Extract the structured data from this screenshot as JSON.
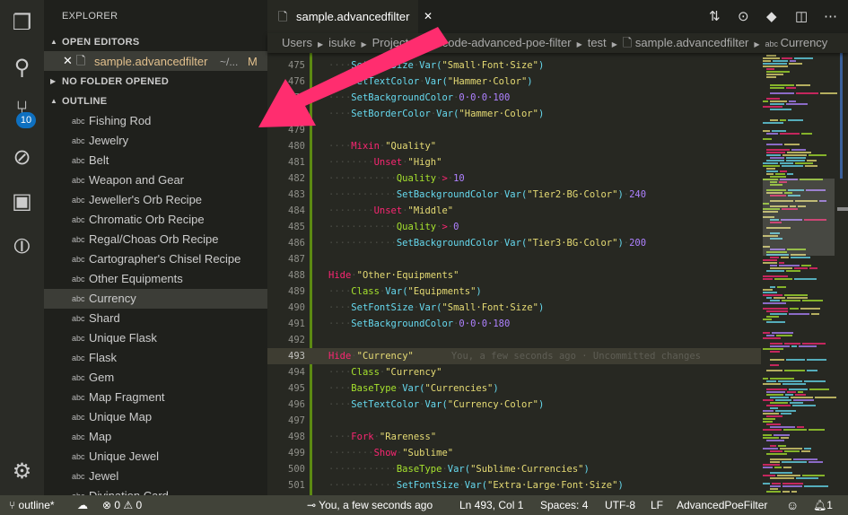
{
  "activity": {
    "scm_badge": "10",
    "icons": [
      "files-icon",
      "search-icon",
      "source-control-icon",
      "debug-icon",
      "extensions-icon",
      "git-graph-icon",
      "gear-icon"
    ]
  },
  "sidebar": {
    "title": "EXPLORER",
    "open_editors": "OPEN EDITORS",
    "open_file": {
      "name": "sample.advancedfilter",
      "path": "~/...",
      "status": "M"
    },
    "no_folder": "NO FOLDER OPENED",
    "outline": "OUTLINE",
    "outline_items": [
      "Fishing Rod",
      "Jewelry",
      "Belt",
      "Weapon and Gear",
      "Jeweller's Orb Recipe",
      "Chromatic Orb Recipe",
      "Regal/Choas Orb Recipe",
      "Cartographer's Chisel Recipe",
      "Other Equipments",
      "Currency",
      "Shard",
      "Unique Flask",
      "Flask",
      "Gem",
      "Map Fragment",
      "Unique Map",
      "Map",
      "Unique Jewel",
      "Jewel",
      "Divination Card"
    ],
    "selected": "Currency",
    "symbol_icon": "abc"
  },
  "tab": {
    "label": "sample.advancedfilter"
  },
  "breadcrumb": [
    "Users",
    "isuke",
    "Projects",
    "vscode-advanced-poe-filter",
    "test",
    "sample.advancedfilter",
    "Currency"
  ],
  "editor": {
    "current_line": 493,
    "blame": "You, a few seconds ago · Uncommitted changes",
    "lines": [
      {
        "n": 475,
        "t": [
          [
            "w",
            "····"
          ],
          [
            "f",
            "SetFontSize"
          ],
          [
            "w",
            "·"
          ],
          [
            "f",
            "Var("
          ],
          [
            "s",
            "\"Small·Font·Size\""
          ],
          [
            "f",
            ")"
          ]
        ]
      },
      {
        "n": 476,
        "t": [
          [
            "w",
            "····"
          ],
          [
            "f",
            "SetTextColor"
          ],
          [
            "w",
            "·"
          ],
          [
            "f",
            "Var("
          ],
          [
            "s",
            "\"Hammer·Color\""
          ],
          [
            "f",
            ")"
          ]
        ]
      },
      {
        "n": 477,
        "t": [
          [
            "w",
            "····"
          ],
          [
            "f",
            "SetBackgroundColor"
          ],
          [
            "w",
            "·"
          ],
          [
            "n",
            "0·0·0·100"
          ]
        ]
      },
      {
        "n": 478,
        "t": [
          [
            "w",
            "····"
          ],
          [
            "f",
            "SetBorderColor"
          ],
          [
            "w",
            "·"
          ],
          [
            "f",
            "Var("
          ],
          [
            "s",
            "\"Hammer·Color\""
          ],
          [
            "f",
            ")"
          ]
        ]
      },
      {
        "n": 479,
        "t": []
      },
      {
        "n": 480,
        "t": [
          [
            "w",
            "····"
          ],
          [
            "k",
            "Mixin"
          ],
          [
            "w",
            "·"
          ],
          [
            "s",
            "\"Quality\""
          ]
        ]
      },
      {
        "n": 481,
        "t": [
          [
            "w",
            "········"
          ],
          [
            "k",
            "Unset"
          ],
          [
            "w",
            "·"
          ],
          [
            "s",
            "\"High\""
          ]
        ]
      },
      {
        "n": 482,
        "t": [
          [
            "w",
            "············"
          ],
          [
            "g",
            "Quality"
          ],
          [
            "w",
            "·"
          ],
          [
            "k",
            ">"
          ],
          [
            "w",
            "·"
          ],
          [
            "n",
            "10"
          ]
        ]
      },
      {
        "n": 483,
        "t": [
          [
            "w",
            "············"
          ],
          [
            "f",
            "SetBackgroundColor"
          ],
          [
            "w",
            "·"
          ],
          [
            "f",
            "Var("
          ],
          [
            "s",
            "\"Tier2·BG·Color\""
          ],
          [
            "f",
            ")"
          ],
          [
            "w",
            "·"
          ],
          [
            "n",
            "240"
          ]
        ]
      },
      {
        "n": 484,
        "t": [
          [
            "w",
            "········"
          ],
          [
            "k",
            "Unset"
          ],
          [
            "w",
            "·"
          ],
          [
            "s",
            "\"Middle\""
          ]
        ]
      },
      {
        "n": 485,
        "t": [
          [
            "w",
            "············"
          ],
          [
            "g",
            "Quality"
          ],
          [
            "w",
            "·"
          ],
          [
            "k",
            ">"
          ],
          [
            "w",
            "·"
          ],
          [
            "n",
            "0"
          ]
        ]
      },
      {
        "n": 486,
        "t": [
          [
            "w",
            "············"
          ],
          [
            "f",
            "SetBackgroundColor"
          ],
          [
            "w",
            "·"
          ],
          [
            "f",
            "Var("
          ],
          [
            "s",
            "\"Tier3·BG·Color\""
          ],
          [
            "f",
            ")"
          ],
          [
            "w",
            "·"
          ],
          [
            "n",
            "200"
          ]
        ]
      },
      {
        "n": 487,
        "t": []
      },
      {
        "n": 488,
        "t": [
          [
            "k",
            "Hide"
          ],
          [
            "w",
            "·"
          ],
          [
            "s",
            "\"Other·Equipments\""
          ]
        ]
      },
      {
        "n": 489,
        "t": [
          [
            "w",
            "····"
          ],
          [
            "g",
            "Class"
          ],
          [
            "w",
            "·"
          ],
          [
            "f",
            "Var("
          ],
          [
            "s",
            "\"Equipments\""
          ],
          [
            "f",
            ")"
          ]
        ]
      },
      {
        "n": 490,
        "t": [
          [
            "w",
            "····"
          ],
          [
            "f",
            "SetFontSize"
          ],
          [
            "w",
            "·"
          ],
          [
            "f",
            "Var("
          ],
          [
            "s",
            "\"Small·Font·Size\""
          ],
          [
            "f",
            ")"
          ]
        ]
      },
      {
        "n": 491,
        "t": [
          [
            "w",
            "····"
          ],
          [
            "f",
            "SetBackgroundColor"
          ],
          [
            "w",
            "·"
          ],
          [
            "n",
            "0·0·0·180"
          ]
        ]
      },
      {
        "n": 492,
        "t": []
      },
      {
        "n": 493,
        "t": [
          [
            "k",
            "Hide"
          ],
          [
            "w",
            "·"
          ],
          [
            "s",
            "\"Currency\""
          ]
        ]
      },
      {
        "n": 494,
        "t": [
          [
            "w",
            "····"
          ],
          [
            "g",
            "Class"
          ],
          [
            "w",
            "·"
          ],
          [
            "s",
            "\"Currency\""
          ]
        ]
      },
      {
        "n": 495,
        "t": [
          [
            "w",
            "····"
          ],
          [
            "g",
            "BaseType"
          ],
          [
            "w",
            "·"
          ],
          [
            "f",
            "Var("
          ],
          [
            "s",
            "\"Currencies\""
          ],
          [
            "f",
            ")"
          ]
        ]
      },
      {
        "n": 496,
        "t": [
          [
            "w",
            "····"
          ],
          [
            "f",
            "SetTextColor"
          ],
          [
            "w",
            "·"
          ],
          [
            "f",
            "Var("
          ],
          [
            "s",
            "\"Currency·Color\""
          ],
          [
            "f",
            ")"
          ]
        ]
      },
      {
        "n": 497,
        "t": []
      },
      {
        "n": 498,
        "t": [
          [
            "w",
            "····"
          ],
          [
            "k",
            "Fork"
          ],
          [
            "w",
            "·"
          ],
          [
            "s",
            "\"Rareness\""
          ]
        ]
      },
      {
        "n": 499,
        "t": [
          [
            "w",
            "········"
          ],
          [
            "k",
            "Show"
          ],
          [
            "w",
            "·"
          ],
          [
            "s",
            "\"Sublime\""
          ]
        ]
      },
      {
        "n": 500,
        "t": [
          [
            "w",
            "············"
          ],
          [
            "g",
            "BaseType"
          ],
          [
            "w",
            "·"
          ],
          [
            "f",
            "Var("
          ],
          [
            "s",
            "\"Sublime·Currencies\""
          ],
          [
            "f",
            ")"
          ]
        ]
      },
      {
        "n": 501,
        "t": [
          [
            "w",
            "············"
          ],
          [
            "f",
            "SetFontSize"
          ],
          [
            "w",
            "·"
          ],
          [
            "f",
            "Var("
          ],
          [
            "s",
            "\"Extra·Large·Font·Size\""
          ],
          [
            "f",
            ")"
          ]
        ]
      }
    ]
  },
  "status": {
    "branch": "outline*",
    "errors": "0",
    "warnings": "0",
    "blame": "You, a few seconds ago",
    "position": "Ln 493, Col 1",
    "spaces": "Spaces: 4",
    "encoding": "UTF-8",
    "eol": "LF",
    "language": "AdvancedPoeFilter",
    "notifications": "1"
  },
  "colors": {
    "accent_arrow": "#ff2d6f",
    "gutter_modified": "#5c8a12",
    "badge": "#0e70c0"
  }
}
